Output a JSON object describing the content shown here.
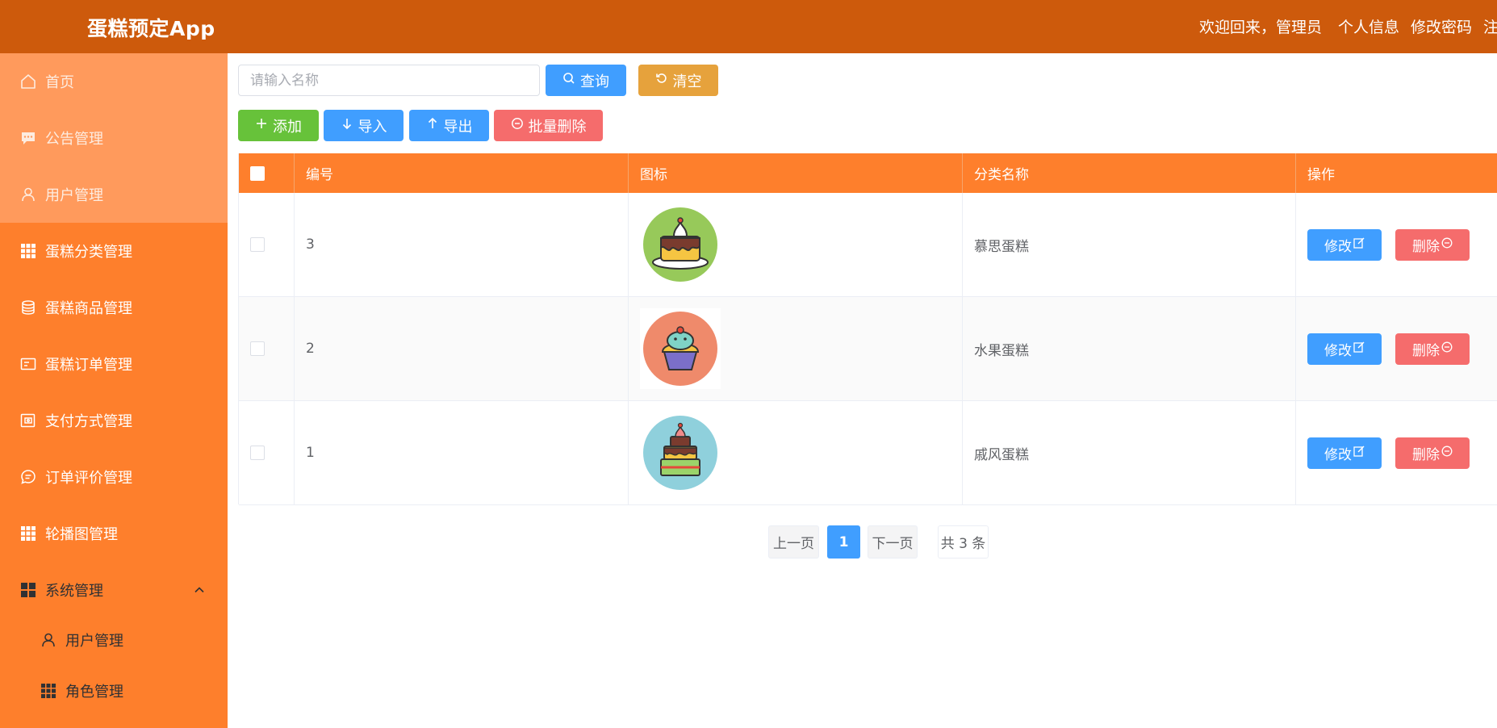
{
  "header": {
    "brand": "蛋糕预定App",
    "welcome": "欢迎回来，管理员",
    "profile": "个人信息",
    "change_password": "修改密码",
    "logout": "注销"
  },
  "sidebar": {
    "items": [
      {
        "label": "首页",
        "icon": "home-icon"
      },
      {
        "label": "公告管理",
        "icon": "chat-icon"
      },
      {
        "label": "用户管理",
        "icon": "user-icon"
      },
      {
        "label": "蛋糕分类管理",
        "icon": "grid-icon"
      },
      {
        "label": "蛋糕商品管理",
        "icon": "database-icon"
      },
      {
        "label": "蛋糕订单管理",
        "icon": "tickets-icon"
      },
      {
        "label": "支付方式管理",
        "icon": "wallet-icon"
      },
      {
        "label": "订单评价管理",
        "icon": "comment-icon"
      },
      {
        "label": "轮播图管理",
        "icon": "grid-icon"
      },
      {
        "label": "系统管理",
        "icon": "menu-icon"
      },
      {
        "label": "用户管理",
        "icon": "user-icon"
      },
      {
        "label": "角色管理",
        "icon": "grid-icon"
      }
    ]
  },
  "toolbar": {
    "search_placeholder": "请输入名称",
    "query": "查询",
    "clear": "清空",
    "add": "添加",
    "import": "导入",
    "export": "导出",
    "batch_delete": "批量删除"
  },
  "table": {
    "columns": [
      "编号",
      "图标",
      "分类名称",
      "操作"
    ],
    "edit_label": "修改",
    "delete_label": "删除",
    "rows": [
      {
        "id": "3",
        "name": "慕思蛋糕"
      },
      {
        "id": "2",
        "name": "水果蛋糕"
      },
      {
        "id": "1",
        "name": "戚风蛋糕"
      }
    ]
  },
  "pagination": {
    "prev": "上一页",
    "current": "1",
    "next": "下一页",
    "total": "共 3 条"
  },
  "colors": {
    "header": "#cd5a0c",
    "sidebar": "#fe7f2c",
    "primary": "#409eff",
    "danger": "#f56c6c",
    "success": "#67c23a",
    "warning": "#e6a23c"
  }
}
